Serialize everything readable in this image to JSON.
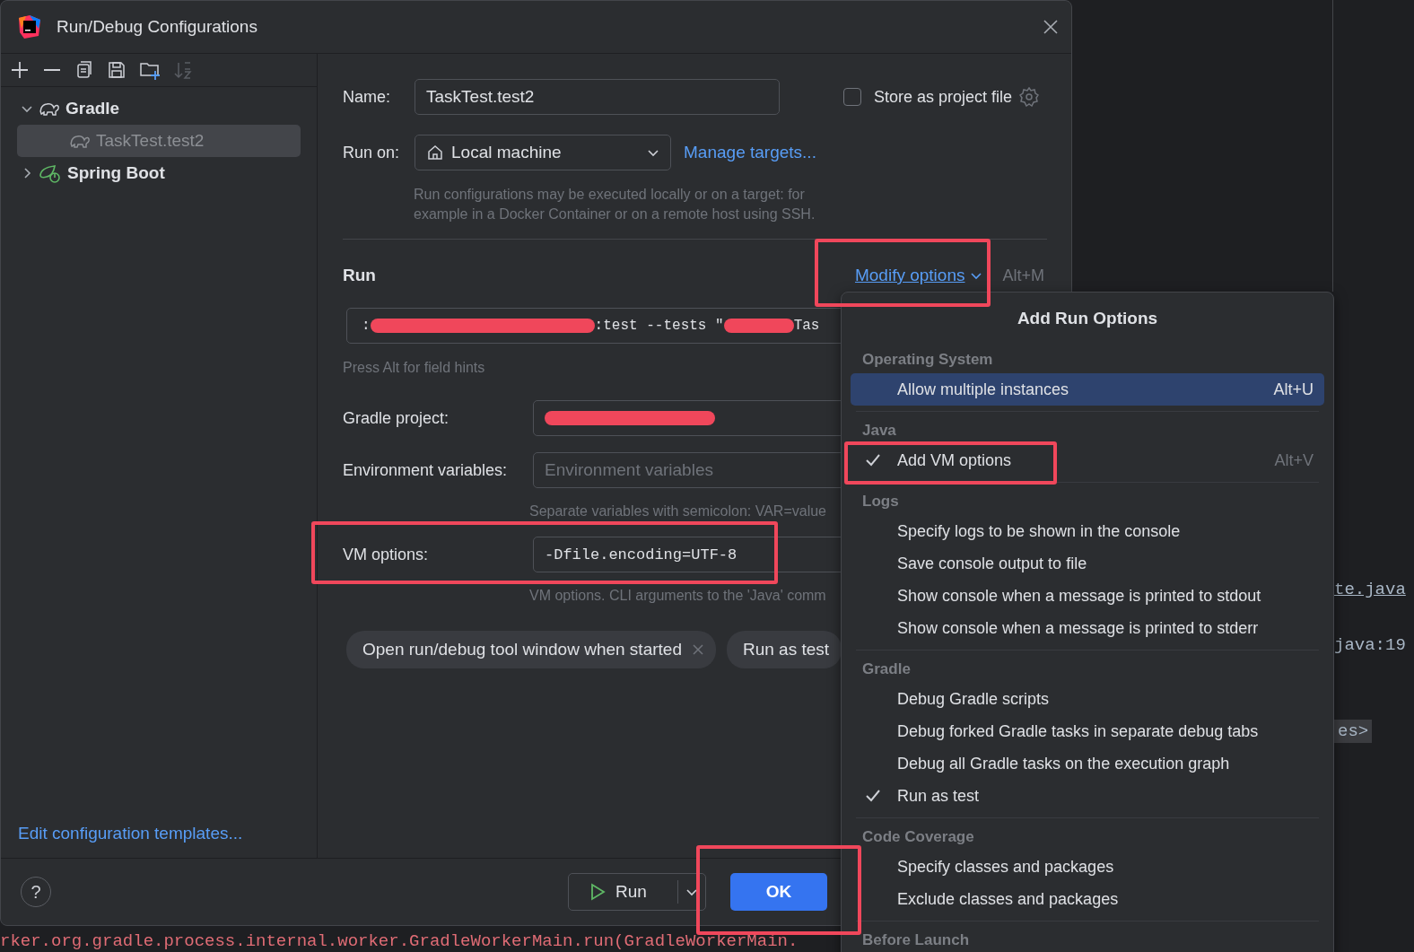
{
  "dialog": {
    "title": "Run/Debug Configurations"
  },
  "tree": [
    {
      "label": "Gradle",
      "expanded": true,
      "selected": false,
      "children": [
        {
          "label": "TaskTest.test2",
          "selected": true
        }
      ]
    },
    {
      "label": "Spring Boot",
      "expanded": false,
      "selected": false
    }
  ],
  "edit_templates_link": "Edit configuration templates...",
  "form": {
    "name_label": "Name:",
    "name_value": "TaskTest.test2",
    "store_checkbox": {
      "label": "Store as project file",
      "checked": false
    },
    "run_on_label": "Run on:",
    "run_on_value": "Local machine",
    "manage_targets": "Manage targets...",
    "run_on_hint_lines": [
      "Run configurations may be executed locally or on a target: for",
      "example in a Docker Container or on a remote host using SSH."
    ],
    "section_title": "Run",
    "modify_options": "Modify options",
    "modify_shortcut": "Alt+M",
    "command_parts": [
      ":",
      ":test --tests \"",
      "Tas"
    ],
    "field_hint": "Press Alt for field hints",
    "fields": [
      {
        "kind": "redacted",
        "label": "Gradle project:"
      },
      {
        "kind": "text",
        "label": "Environment variables:",
        "placeholder": "Environment variables",
        "hint": "Separate variables with semicolon: VAR=value"
      },
      {
        "kind": "mono",
        "label": "VM options:",
        "value": "-Dfile.encoding=UTF-8",
        "hint": "VM options. CLI arguments to the 'Java' comm"
      }
    ],
    "chips": [
      {
        "label": "Open run/debug tool window when started",
        "removable": true
      },
      {
        "label": "Run as test",
        "removable": false
      }
    ]
  },
  "footer": {
    "help": "?",
    "run_button": "Run",
    "ok_button": "OK"
  },
  "popup": {
    "title": "Add Run Options",
    "groups": [
      {
        "header": "Operating System",
        "items": [
          {
            "label": "Allow multiple instances",
            "shortcut": "Alt+U",
            "checked": false,
            "selected": true
          }
        ]
      },
      {
        "header": "Java",
        "items": [
          {
            "label": "Add VM options",
            "shortcut": "Alt+V",
            "checked": true,
            "selected": false
          }
        ]
      },
      {
        "header": "Logs",
        "items": [
          {
            "label": "Specify logs to be shown in the console",
            "checked": false,
            "selected": false
          },
          {
            "label": "Save console output to file",
            "checked": false,
            "selected": false
          },
          {
            "label": "Show console when a message is printed to stdout",
            "checked": false,
            "selected": false
          },
          {
            "label": "Show console when a message is printed to stderr",
            "checked": false,
            "selected": false
          }
        ]
      },
      {
        "header": "Gradle",
        "items": [
          {
            "label": "Debug Gradle scripts",
            "checked": false,
            "selected": false
          },
          {
            "label": "Debug forked Gradle tasks in separate debug tabs",
            "checked": false,
            "selected": false
          },
          {
            "label": "Debug all Gradle tasks on the execution graph",
            "checked": false,
            "selected": false
          },
          {
            "label": "Run as test",
            "checked": true,
            "selected": false
          }
        ]
      },
      {
        "header": "Code Coverage",
        "items": [
          {
            "label": "Specify classes and packages",
            "checked": false,
            "selected": false
          },
          {
            "label": "Exclude classes and packages",
            "checked": false,
            "selected": false
          }
        ]
      },
      {
        "header": "Before Launch"
      }
    ]
  },
  "editor": {
    "fragments": [
      "te.java",
      "java:19",
      "es>"
    ],
    "console_line": "rker.org.gradle.process.internal.worker.GradleWorkerMain.run(GradleWorkerMain."
  }
}
